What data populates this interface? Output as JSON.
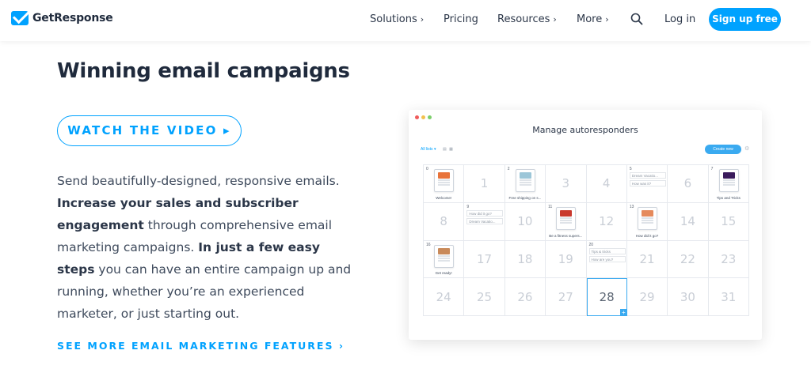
{
  "brand": {
    "name": "GetResponse"
  },
  "nav": {
    "items": [
      {
        "label": "Solutions",
        "chevron": "›"
      },
      {
        "label": "Pricing",
        "chevron": ""
      },
      {
        "label": "Resources",
        "chevron": "›"
      },
      {
        "label": "More",
        "chevron": "›"
      }
    ],
    "login": "Log in",
    "signup": "Sign up free"
  },
  "hero": {
    "title": "Winning email campaigns",
    "video_button": "WATCH THE VIDEO ▸",
    "body_1": "Send beautifully-designed, responsive emails. ",
    "body_2_bold": "Increase your sales and subscriber engagement",
    "body_3": " through comprehensive email marketing campaigns. ",
    "body_4_bold": "In just a few easy steps",
    "body_5": " you can have an entire campaign up and running, whether you’re an experienced marketer, or just starting out.",
    "more_link": "SEE MORE EMAIL MARKETING FEATURES ›"
  },
  "app": {
    "title": "Manage autoresponders",
    "all_lists": "All lists ▾",
    "create_button": "Create new",
    "colors": {
      "accent": "#3aaaf0",
      "dot_red": "#ef5b5b",
      "dot_yellow": "#f2c14e",
      "dot_green": "#7ccf6b"
    },
    "calendar": [
      {
        "day": "0",
        "type": "email",
        "label": "Welcome!",
        "thumb": "#e8733a"
      },
      {
        "day": "1",
        "type": "num"
      },
      {
        "day": "2",
        "type": "email",
        "label": "Free shipping on s...",
        "thumb": "#9cc6d8"
      },
      {
        "day": "3",
        "type": "num"
      },
      {
        "day": "4",
        "type": "num"
      },
      {
        "day": "5",
        "type": "chips",
        "chips": [
          "Dream Vacatio...",
          "How was it?"
        ]
      },
      {
        "day": "6",
        "type": "num"
      },
      {
        "day": "7",
        "type": "email",
        "label": "Tips and Tricks",
        "thumb": "#3b1b5c"
      },
      {
        "day": "8",
        "type": "num"
      },
      {
        "day": "9",
        "type": "chips",
        "chips": [
          "How did it go?",
          "Dream Vacatio..."
        ]
      },
      {
        "day": "10",
        "type": "num"
      },
      {
        "day": "11",
        "type": "email",
        "label": "Be a fitness supers...",
        "thumb": "#c9392d"
      },
      {
        "day": "12",
        "type": "num"
      },
      {
        "day": "13",
        "type": "email",
        "label": "How did it go?",
        "thumb": "#e58a5c"
      },
      {
        "day": "14",
        "type": "num"
      },
      {
        "day": "15",
        "type": "num"
      },
      {
        "day": "16",
        "type": "email",
        "label": "Get ready!",
        "thumb": "#c98a5a"
      },
      {
        "day": "17",
        "type": "num"
      },
      {
        "day": "18",
        "type": "num"
      },
      {
        "day": "19",
        "type": "num"
      },
      {
        "day": "20",
        "type": "chips",
        "chips": [
          "Tips & tricks",
          "How are you?"
        ]
      },
      {
        "day": "21",
        "type": "num"
      },
      {
        "day": "22",
        "type": "num"
      },
      {
        "day": "23",
        "type": "num"
      },
      {
        "day": "24",
        "type": "num"
      },
      {
        "day": "25",
        "type": "num"
      },
      {
        "day": "26",
        "type": "num"
      },
      {
        "day": "27",
        "type": "num"
      },
      {
        "day": "28",
        "type": "num",
        "highlight": true
      },
      {
        "day": "29",
        "type": "num"
      },
      {
        "day": "30",
        "type": "num"
      },
      {
        "day": "31",
        "type": "num"
      }
    ]
  }
}
